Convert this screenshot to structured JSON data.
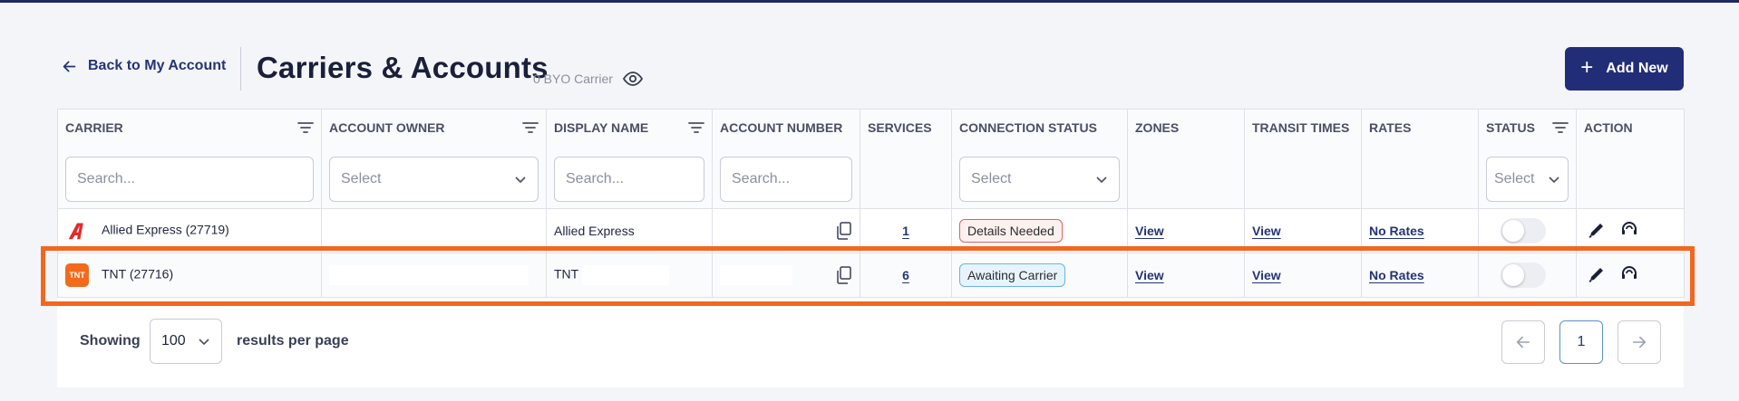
{
  "header": {
    "back_label": "Back to My Account",
    "title": "Carriers & Accounts",
    "byo_count": "0 BYO Carrier",
    "add_new_label": "Add New"
  },
  "table": {
    "columns": [
      {
        "label": "CARRIER",
        "sortable": true,
        "filter": "Search..."
      },
      {
        "label": "ACCOUNT OWNER",
        "sortable": true,
        "filter": "Select"
      },
      {
        "label": "DISPLAY NAME",
        "sortable": true,
        "filter": "Search..."
      },
      {
        "label": "ACCOUNT NUMBER",
        "sortable": false,
        "filter": "Search..."
      },
      {
        "label": "SERVICES",
        "sortable": false,
        "filter": ""
      },
      {
        "label": "CONNECTION STATUS",
        "sortable": false,
        "filter": "Select"
      },
      {
        "label": "ZONES",
        "sortable": false,
        "filter": ""
      },
      {
        "label": "TRANSIT TIMES",
        "sortable": false,
        "filter": ""
      },
      {
        "label": "RATES",
        "sortable": false,
        "filter": ""
      },
      {
        "label": "STATUS",
        "sortable": true,
        "filter": "Select"
      },
      {
        "label": "ACTION",
        "sortable": false,
        "filter": ""
      }
    ],
    "rows": [
      {
        "carrier": "Allied Express (27719)",
        "logo": "allied-express-logo",
        "account_owner": "",
        "display_name": "Allied Express",
        "account_number": "",
        "services": "1",
        "connection_status": "Details Needed",
        "status_color": "#e0605a",
        "zones": "View",
        "transit_times": "View",
        "rates": "No Rates",
        "enabled": false
      },
      {
        "carrier": "TNT (27716)",
        "logo": "tnt-logo",
        "logo_text": "TNT",
        "account_owner": "",
        "display_name": "TNT",
        "account_number": "",
        "services": "6",
        "connection_status": "Awaiting Carrier",
        "status_color": "#6bb3e6",
        "zones": "View",
        "transit_times": "View",
        "rates": "No Rates",
        "enabled": false
      }
    ]
  },
  "footer": {
    "showing_label": "Showing",
    "per_page_value": "100",
    "results_label": "results per page",
    "current_page": "1"
  },
  "colors": {
    "brand": "#222d78",
    "highlight": "#f4661f"
  }
}
